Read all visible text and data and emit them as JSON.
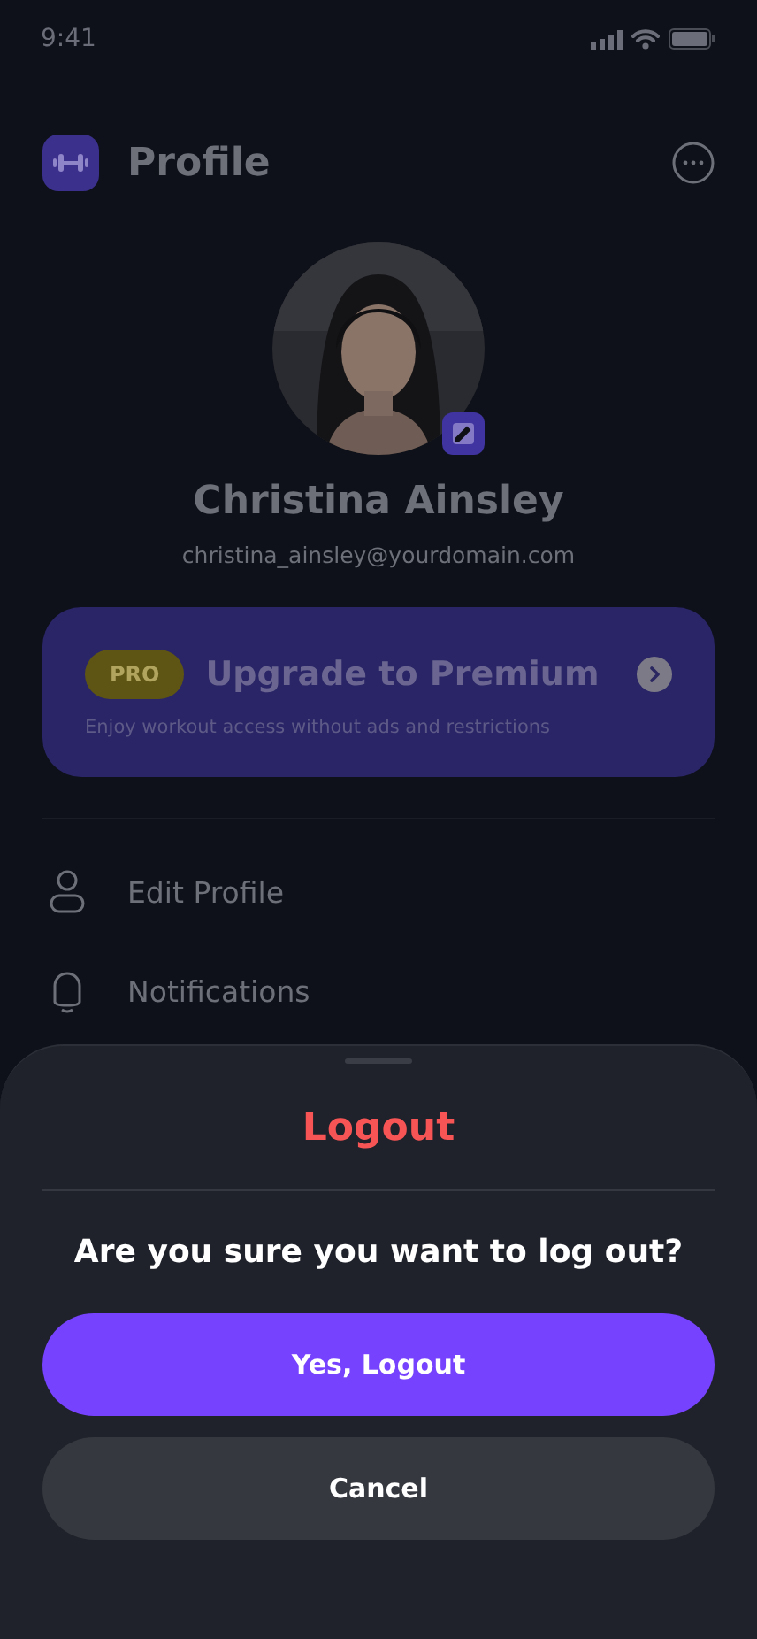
{
  "status_bar": {
    "time": "9:41"
  },
  "header": {
    "title": "Profile"
  },
  "profile": {
    "name": "Christina Ainsley",
    "email": "christina_ainsley@yourdomain.com"
  },
  "premium": {
    "badge": "PRO",
    "title": "Upgrade to Premium",
    "subtitle": "Enjoy workout access without ads and restrictions"
  },
  "menu": [
    {
      "kind": "person",
      "label": "Edit Profile"
    },
    {
      "kind": "bell",
      "label": "Notifications"
    }
  ],
  "sheet": {
    "title": "Logout",
    "message": "Are you sure you want to log out?",
    "buttons": [
      {
        "kind": "primary",
        "label": "Yes, Logout"
      },
      {
        "kind": "secondary",
        "label": "Cancel"
      }
    ]
  }
}
